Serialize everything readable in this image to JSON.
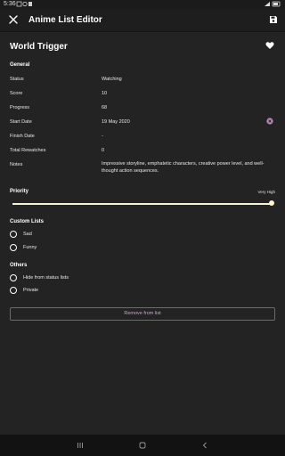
{
  "status_bar": {
    "time": "5:36"
  },
  "app_bar": {
    "title": "Anime List Editor",
    "close_icon": "close-icon",
    "save_icon": "save-icon"
  },
  "media": {
    "title": "World Trigger",
    "favorite_icon": "heart-icon",
    "favorited": true
  },
  "general": {
    "heading": "General",
    "rows": [
      {
        "label": "Status",
        "value": "Watching"
      },
      {
        "label": "Score",
        "value": "10"
      },
      {
        "label": "Progress",
        "value": "68"
      },
      {
        "label": "Start Date",
        "value": "19 May 2020"
      },
      {
        "label": "Finish Date",
        "value": "-"
      },
      {
        "label": "Total Rewatches",
        "value": "0"
      },
      {
        "label": "Notes",
        "value": "Impressive storyline, emphatetic characters, creative power level, and well-thought action sequences."
      }
    ]
  },
  "priority": {
    "label": "Priority",
    "value": "Very High",
    "level_fraction": 1.0
  },
  "custom_lists": {
    "heading": "Custom Lists",
    "items": [
      {
        "label": "Sad",
        "checked": false
      },
      {
        "label": "Funny",
        "checked": false
      }
    ]
  },
  "others": {
    "heading": "Others",
    "items": [
      {
        "label": "Hide from status lists",
        "checked": false
      },
      {
        "label": "Private",
        "checked": false
      }
    ]
  },
  "remove_button": {
    "label": "Remove from list"
  },
  "colors": {
    "background": "#232323",
    "app_bar": "#1e1e1e",
    "accent": "#f6f2d4",
    "remove_text": "#c8a6c6",
    "clear_icon": "#b98ab5"
  }
}
